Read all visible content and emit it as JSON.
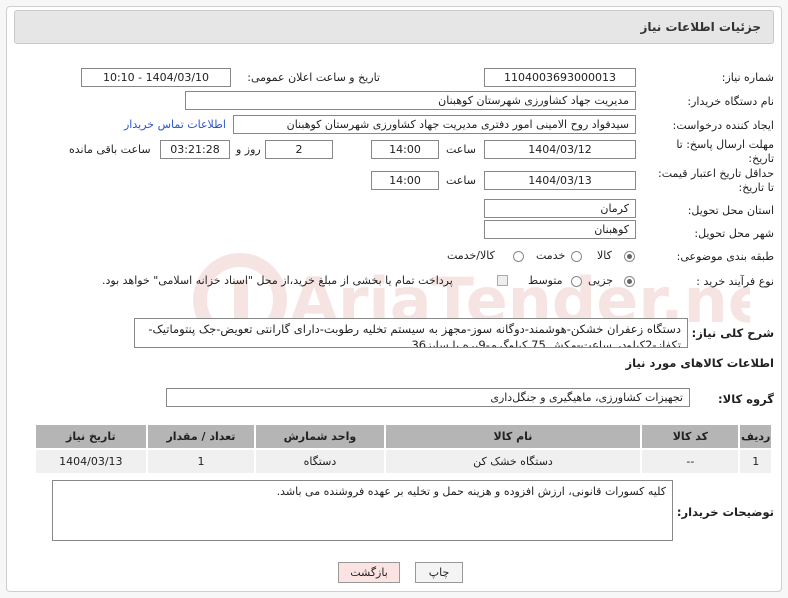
{
  "header": {
    "title": "جزئیات اطلاعات نیاز"
  },
  "form": {
    "need_number": {
      "label": "شماره نیاز:",
      "value": "1104003693000013"
    },
    "announce_datetime": {
      "label": "تاریخ و ساعت اعلان عمومی:",
      "value": "1404/03/10 - 10:10"
    },
    "buyer_org": {
      "label": "نام دستگاه خریدار:",
      "value": "مدیریت جهاد کشاورزی شهرستان کوهبنان"
    },
    "requester": {
      "label": "ایجاد کننده درخواست:",
      "value": "سیدفواد روح الامینی امور دفتری مدیریت جهاد کشاورزی شهرستان کوهبنان",
      "contact_link": "اطلاعات تماس خریدار"
    },
    "response_deadline": {
      "label_line1": "مهلت ارسال پاسخ: تا",
      "label_line2": "تاریخ:",
      "date": "1404/03/12",
      "time_label": "ساعت",
      "time": "14:00",
      "days": "2",
      "days_label": "روز و",
      "remaining": "03:21:28",
      "remaining_label": "ساعت باقی مانده"
    },
    "price_validity": {
      "label_line1": "حداقل تاریخ اعتبار قیمت:",
      "label_line2": "تا تاریخ:",
      "date": "1404/03/13",
      "time_label": "ساعت",
      "time": "14:00"
    },
    "delivery_province": {
      "label": "استان محل تحویل:",
      "value": "کرمان"
    },
    "delivery_city": {
      "label": "شهر محل تحویل:",
      "value": "کوهبنان"
    },
    "category": {
      "label": "طبقه بندی موضوعی:",
      "options": [
        "کالا",
        "خدمت",
        "کالا/خدمت"
      ],
      "selected": "کالا"
    },
    "purchase_type": {
      "label": "نوع فرآیند خرید :",
      "options": [
        "جزیی",
        "متوسط"
      ],
      "selected": "جزیی",
      "treasury_note": "پرداخت تمام یا بخشی از مبلغ خرید،از محل \"اسناد خزانه اسلامی\" خواهد بود."
    },
    "general_description": {
      "label": "شرح کلی نیاز:",
      "value": "دستگاه زعفران خشکن-هوشمند-دوگانه سوز-مجهز به سیستم تخلیه رطوبت-دارای گارانتی تعویض-جک پنتوماتیک-تکفاز-2کیلودر ساعت-مکش 75 کیلوگرم-9پره با سایز36"
    }
  },
  "goods_section": {
    "title": "اطلاعات کالاهای مورد نیاز",
    "group_label": "گروه کالا:",
    "group_value": "تجهیزات کشاورزی، ماهیگیری و جنگل‌داری",
    "columns": [
      "ردیف",
      "کد کالا",
      "نام کالا",
      "واحد شمارش",
      "تعداد / مقدار",
      "تاریخ نیاز"
    ],
    "rows": [
      {
        "row": "1",
        "code": "--",
        "name": "دستگاه خشک کن",
        "unit": "دستگاه",
        "qty": "1",
        "date": "1404/03/13"
      }
    ]
  },
  "buyer_notes": {
    "label": "توضیحات خریدار:",
    "value": "کلیه کسورات قانونی، ارزش افزوده و هزینه حمل و تخلیه بر عهده فروشنده می باشد."
  },
  "buttons": {
    "print": "چاپ",
    "back": "بازگشت"
  },
  "watermark": {
    "text": "AriaTender.neT"
  },
  "colors": {
    "link": "#2a56c6",
    "table_header": "#b5b5b5",
    "back_button_bg": "#fbe3e3",
    "watermark": "#c0392b"
  }
}
